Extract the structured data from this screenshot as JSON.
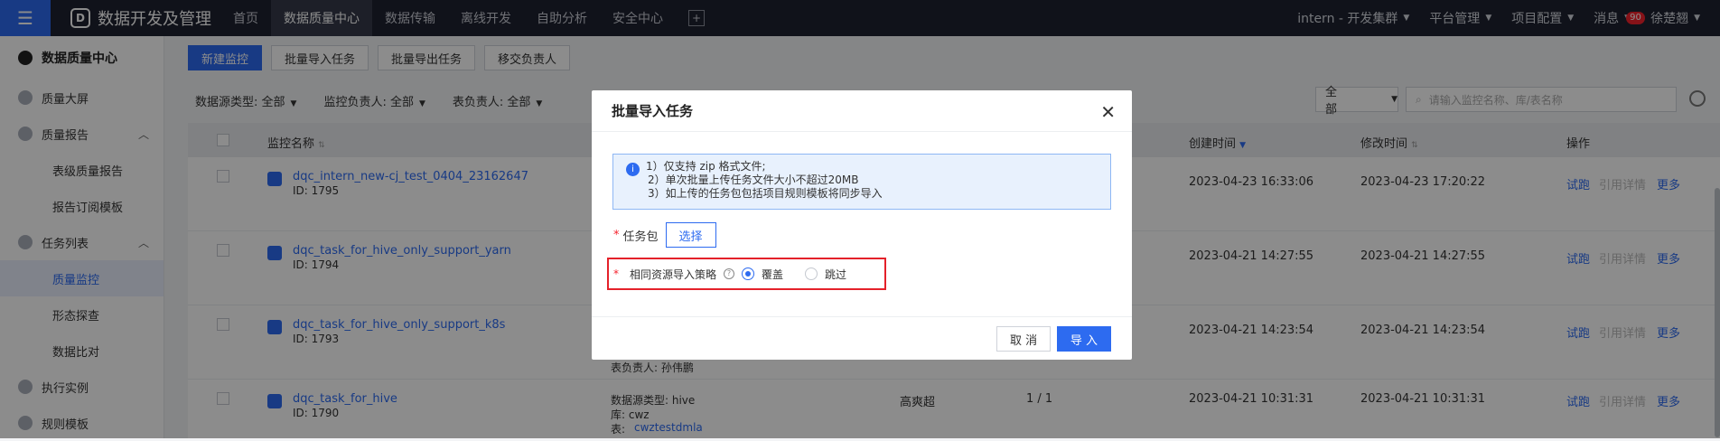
{
  "topbar": {
    "menu_icon": "hamburger-icon",
    "app_title": "数据开发及管理",
    "nav": [
      "首页",
      "数据质量中心",
      "数据传输",
      "离线开发",
      "自助分析",
      "安全中心"
    ],
    "active_nav": "数据质量中心",
    "cluster": "intern - 开发集群",
    "platform": "平台管理",
    "project": "项目配置",
    "messages": "消息",
    "message_count": "90",
    "user": "徐楚翘"
  },
  "sidebar": {
    "header": "数据质量中心",
    "items": [
      {
        "label": "质量大屏",
        "type": "top"
      },
      {
        "label": "质量报告",
        "type": "top"
      },
      {
        "label": "表级质量报告",
        "type": "sub"
      },
      {
        "label": "报告订阅模板",
        "type": "sub"
      },
      {
        "label": "任务列表",
        "type": "top"
      },
      {
        "label": "质量监控",
        "type": "sub"
      },
      {
        "label": "形态探查",
        "type": "sub"
      },
      {
        "label": "数据比对",
        "type": "sub"
      },
      {
        "label": "执行实例",
        "type": "top"
      },
      {
        "label": "规则模板",
        "type": "top"
      }
    ]
  },
  "toolbar": {
    "new_label": "新建监控",
    "import_label": "批量导入任务",
    "export_label": "批量导出任务",
    "transfer_label": "移交负责人"
  },
  "filters": {
    "source_type": "数据源类型: 全部",
    "monitor_owner": "监控负责人: 全部",
    "table_owner": "表负责人: 全部",
    "scope": "全部",
    "search_placeholder": "请输入监控名称、库/表名称"
  },
  "table": {
    "headers": {
      "name": "监控名称",
      "created": "创建时间",
      "modified": "修改时间",
      "ops": "操作"
    },
    "rows": [
      {
        "name": "dqc_intern_new-cj_test_0404_23162647",
        "id": "ID: 1795",
        "created": "2023-04-23 16:33:06",
        "modified": "2023-04-23 17:20:22"
      },
      {
        "name": "dqc_task_for_hive_only_support_yarn",
        "id": "ID: 1794",
        "created": "2023-04-21 14:27:55",
        "modified": "2023-04-21 14:27:55"
      },
      {
        "name": "dqc_task_for_hive_only_support_k8s",
        "id": "ID: 1793",
        "created": "2023-04-21 14:23:54",
        "modified": "2023-04-21 14:23:54",
        "extra": "表负责人: 孙伟鹏"
      },
      {
        "name": "dqc_task_for_hive",
        "id": "ID: 1790",
        "created": "2023-04-21 10:31:31",
        "modified": "2023-04-21 10:31:31",
        "src_type": "数据源类型: hive",
        "db": "库: cwz",
        "tbl_label": "表:",
        "tbl": "cwztestdmla",
        "owner": "高爽超",
        "ratio": "1 / 1"
      }
    ],
    "op_run": "试跑",
    "op_ref": "引用详情",
    "op_more": "更多"
  },
  "modal": {
    "title": "批量导入任务",
    "info_lines": [
      "1）仅支持 zip 格式文件;",
      "2）单次批量上传任务文件大小不超过20MB",
      "3）如上传的任务包包括项目规则模板将同步导入"
    ],
    "package_label": "任务包",
    "choose_label": "选择",
    "strategy_label": "相同资源导入策略",
    "option_overwrite": "覆盖",
    "option_skip": "跳过",
    "cancel_label": "取 消",
    "ok_label": "导 入"
  }
}
